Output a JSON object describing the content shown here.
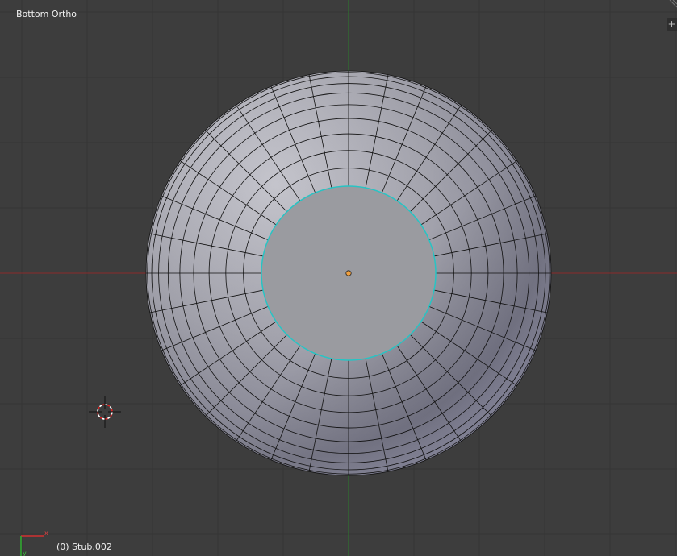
{
  "viewport": {
    "view_name": "Bottom Ortho",
    "active_object": "(0) Stub.002",
    "colors": {
      "background": "#3d3d3d",
      "grid": "#353535",
      "x_axis": "#8a2a2a",
      "y_axis": "#2c7d2c",
      "mesh_light": "#b8b8c0",
      "mesh_dark": "#6a6a78",
      "wire": "#111111",
      "selected_edge": "#27c4c4",
      "origin": "#f0a040"
    },
    "gizmo": {
      "x_label": "x",
      "y_label": "y"
    },
    "tools": {
      "add_region_symbol": "+"
    }
  }
}
